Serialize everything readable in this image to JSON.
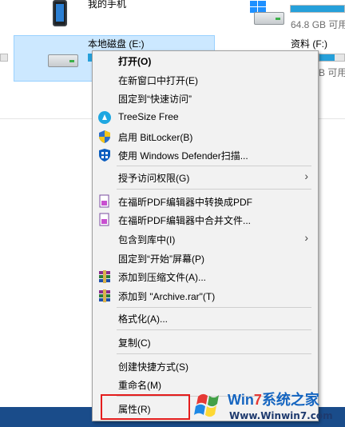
{
  "explorer": {
    "my_phone_label": "我的手机",
    "drive_e_label": "本地磁盘 (E:)",
    "drive_c_free": "64.8 GB 可用，",
    "drive_f_label": "资料 (F:)",
    "drive_f_free": "B 可用"
  },
  "menu": {
    "items": [
      {
        "label": "打开(O)"
      },
      {
        "label": "在新窗口中打开(E)"
      },
      {
        "label": "固定到“快速访问”"
      },
      {
        "label": "TreeSize Free"
      },
      {
        "label": "启用 BitLocker(B)"
      },
      {
        "label": "使用 Windows Defender扫描..."
      },
      {
        "label": "授予访问权限(G)"
      },
      {
        "label": "在福昕PDF编辑器中转换成PDF"
      },
      {
        "label": "在福昕PDF编辑器中合并文件..."
      },
      {
        "label": "包含到库中(I)"
      },
      {
        "label": "固定到“开始”屏幕(P)"
      },
      {
        "label": "添加到压缩文件(A)..."
      },
      {
        "label": "添加到 \"Archive.rar\"(T)"
      },
      {
        "label": "格式化(A)..."
      },
      {
        "label": "复制(C)"
      },
      {
        "label": "创建快捷方式(S)"
      },
      {
        "label": "重命名(M)"
      },
      {
        "label": "属性(R)"
      }
    ]
  },
  "watermark": {
    "brand_win": "Win",
    "brand_7": "7",
    "brand_rest": "系统之家",
    "url": "Www.Winwin7.com"
  },
  "colors": {
    "selection": "#cce8ff",
    "highlight_box": "#e41d1d",
    "menu_bg": "#f2f2f2"
  }
}
